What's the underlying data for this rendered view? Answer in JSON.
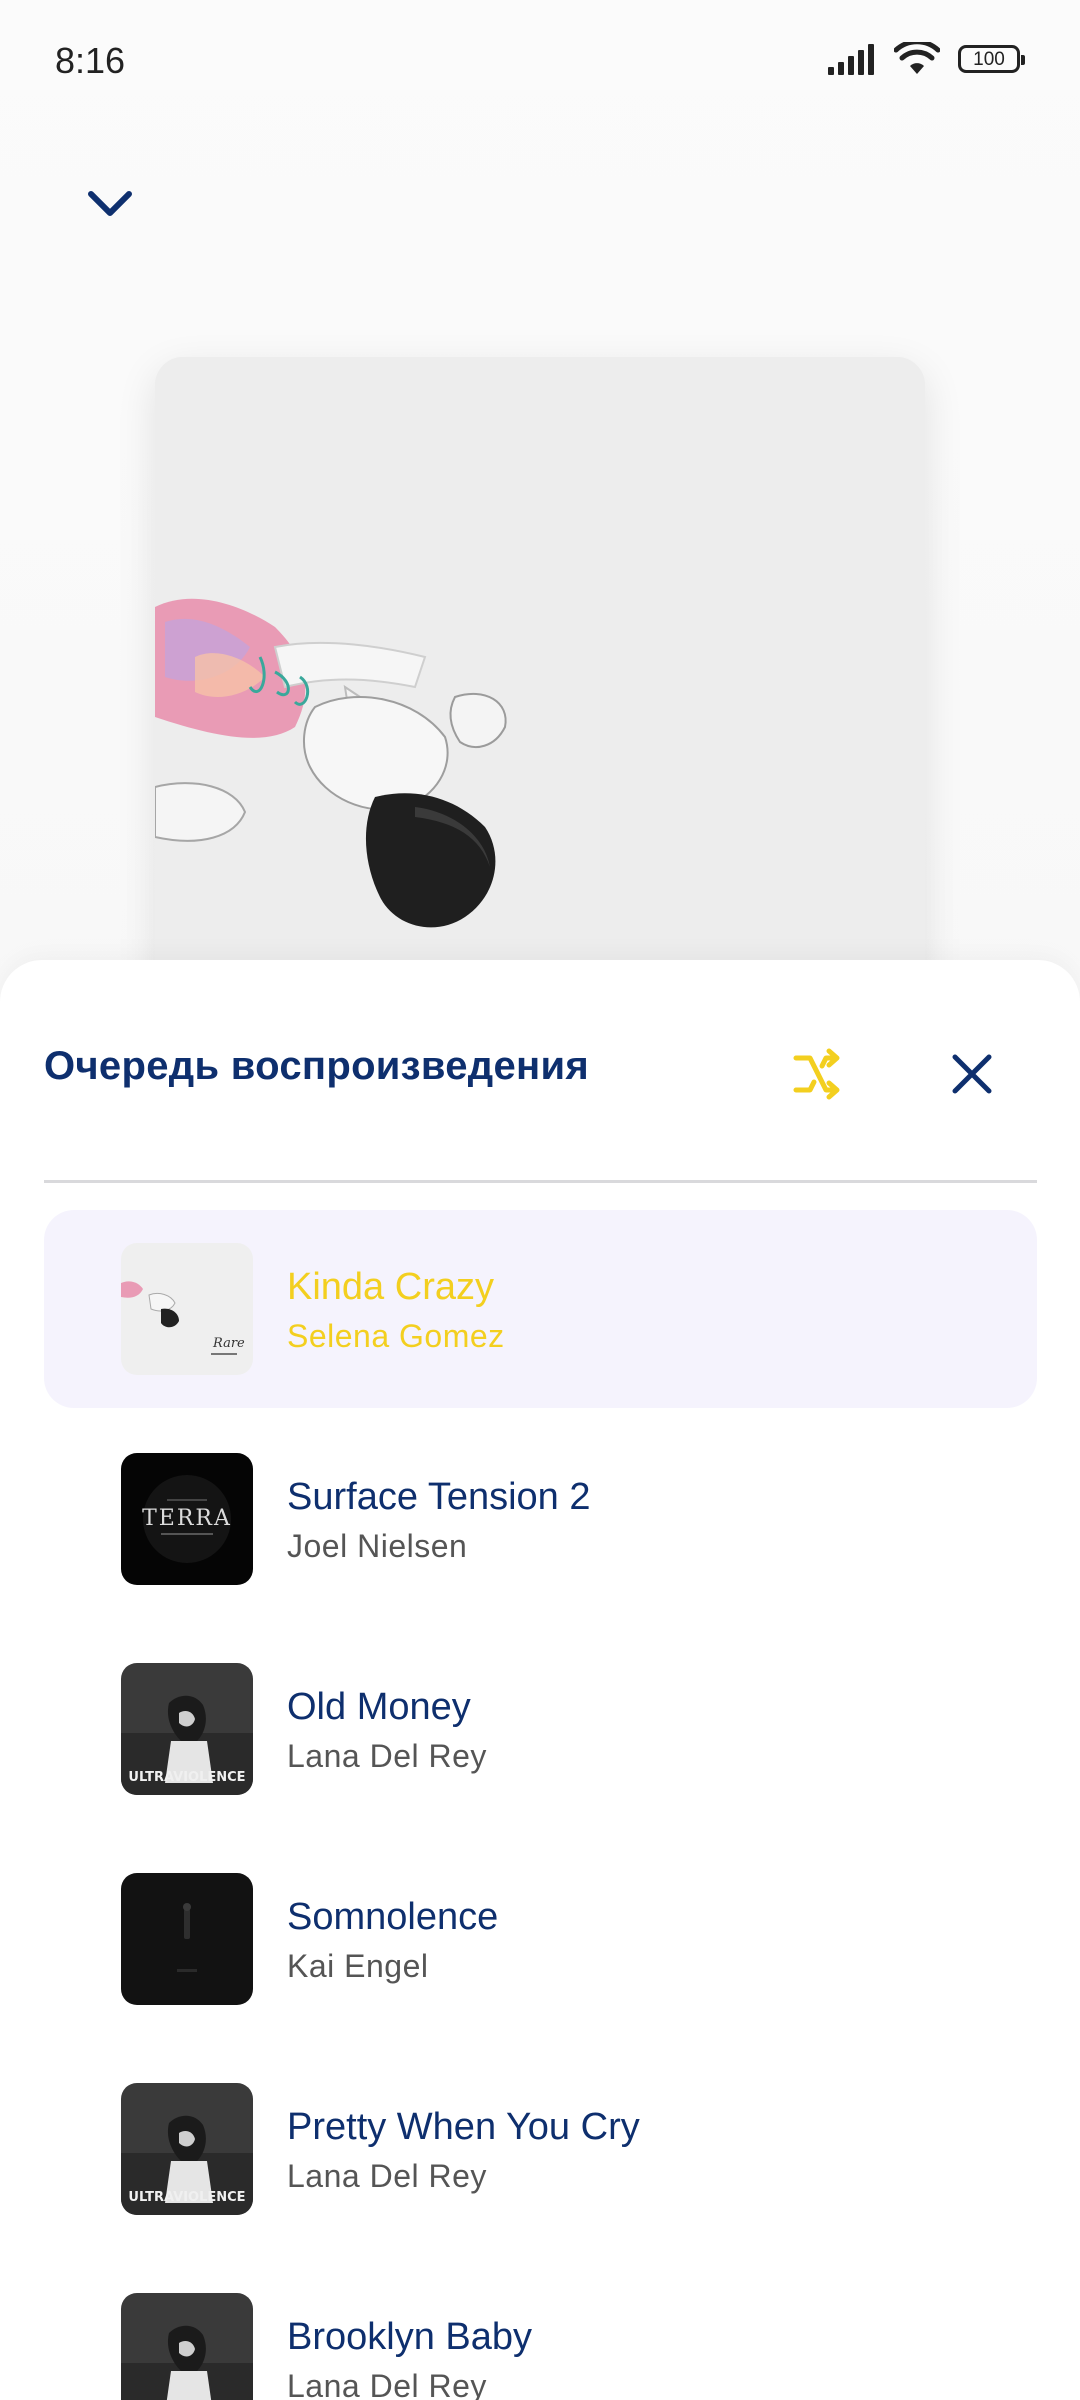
{
  "status_bar": {
    "time": "8:16",
    "battery": "100",
    "icons": [
      "signal-icon",
      "wifi-icon",
      "battery-icon"
    ]
  },
  "player": {
    "collapse_icon": "chevron-down-icon",
    "album_art": "album-cover-rare"
  },
  "queue": {
    "title": "Очередь воспроизведения",
    "shuffle_icon": "shuffle-icon",
    "close_icon": "close-icon",
    "accent_color": "#f3cf1f",
    "title_color": "#0e2f6e",
    "items": [
      {
        "title": "Kinda Crazy",
        "artist": "Selena Gomez",
        "active": true,
        "cover": "rare"
      },
      {
        "title": "Surface Tension 2",
        "artist": "Joel Nielsen",
        "active": false,
        "cover": "terra"
      },
      {
        "title": "Old Money",
        "artist": "Lana Del Rey",
        "active": false,
        "cover": "ultraviolence"
      },
      {
        "title": "Somnolence",
        "artist": "Kai Engel",
        "active": false,
        "cover": "dark"
      },
      {
        "title": "Pretty When You Cry",
        "artist": "Lana Del Rey",
        "active": false,
        "cover": "ultraviolence"
      },
      {
        "title": "Brooklyn Baby",
        "artist": "Lana Del Rey",
        "active": false,
        "cover": "ultraviolence"
      }
    ]
  }
}
